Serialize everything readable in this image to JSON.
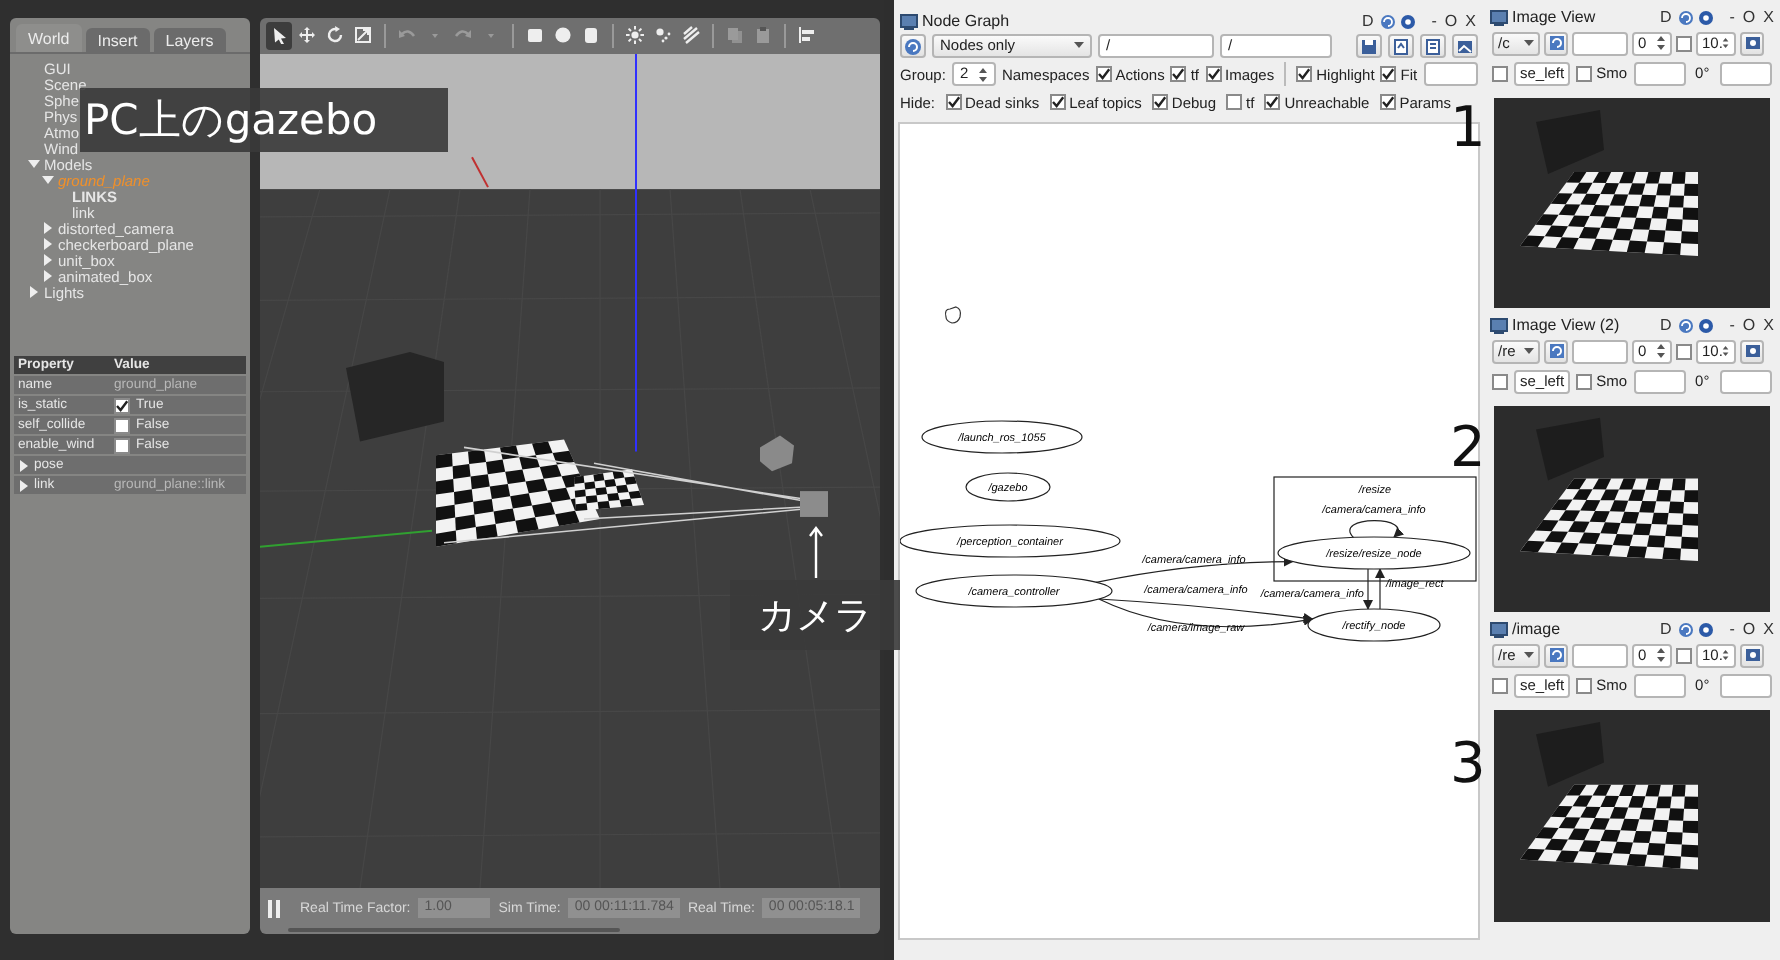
{
  "gazebo": {
    "tabs": [
      {
        "label": "World",
        "selected": true
      },
      {
        "label": "Insert",
        "selected": false
      },
      {
        "label": "Layers",
        "selected": false
      }
    ],
    "tree": [
      {
        "label": "GUI"
      },
      {
        "label": "Scene"
      },
      {
        "label": "Sphe"
      },
      {
        "label": "Phys"
      },
      {
        "label": "Atmo"
      },
      {
        "label": "Wind"
      },
      {
        "label": "Models",
        "expanded": true,
        "children": [
          {
            "label": "ground_plane",
            "expanded": true,
            "selected": true,
            "children": [
              {
                "label": "LINKS",
                "kind": "heading"
              },
              {
                "label": "link",
                "kind": "entry"
              }
            ]
          },
          {
            "label": "distorted_camera",
            "expanded": false,
            "selected": false
          },
          {
            "label": "checkerboard_plane",
            "expanded": false,
            "selected": false
          },
          {
            "label": "unit_box",
            "expanded": false,
            "selected": false
          },
          {
            "label": "animated_box",
            "expanded": false,
            "selected": false
          }
        ]
      },
      {
        "label": "Lights",
        "expanded": false
      }
    ],
    "properties": {
      "columns": [
        "Property",
        "Value"
      ],
      "rows": [
        {
          "kind": "text",
          "name": "name",
          "value": "ground_plane"
        },
        {
          "kind": "check",
          "name": "is_static",
          "checked": true,
          "value": "True"
        },
        {
          "kind": "check",
          "name": "self_collide",
          "checked": false,
          "value": "False"
        },
        {
          "kind": "check",
          "name": "enable_wind",
          "checked": false,
          "value": "False"
        },
        {
          "kind": "group",
          "name": "pose",
          "expanded": false
        },
        {
          "kind": "group",
          "name": "link",
          "expanded": false,
          "value": "ground_plane::link"
        }
      ]
    },
    "tools": [
      {
        "kind": "select",
        "selected": true,
        "disabled": false
      },
      {
        "kind": "translate",
        "selected": false,
        "disabled": false
      },
      {
        "kind": "rotate",
        "selected": false,
        "disabled": false
      },
      {
        "kind": "scale",
        "selected": false,
        "disabled": false
      },
      {
        "kind": "undo",
        "selected": false,
        "disabled": true
      },
      {
        "kind": "caret",
        "selected": false,
        "disabled": true
      },
      {
        "kind": "redo",
        "selected": false,
        "disabled": true
      },
      {
        "kind": "caret",
        "selected": false,
        "disabled": true
      },
      {
        "kind": "box",
        "selected": false,
        "disabled": false
      },
      {
        "kind": "sphere",
        "selected": false,
        "disabled": false
      },
      {
        "kind": "cylinder",
        "selected": false,
        "disabled": false
      },
      {
        "kind": "pointlight",
        "selected": false,
        "disabled": false
      },
      {
        "kind": "spotlight",
        "selected": false,
        "disabled": false
      },
      {
        "kind": "dirlight",
        "selected": false,
        "disabled": false
      },
      {
        "kind": "copy",
        "selected": false,
        "disabled": true
      },
      {
        "kind": "paste",
        "selected": false,
        "disabled": true
      },
      {
        "kind": "align",
        "selected": false,
        "disabled": false
      }
    ],
    "status": {
      "rtf_label": "Real Time Factor:",
      "rtf": "1.00",
      "sim_label": "Sim Time:",
      "sim": "00 00:11:11.784",
      "real_label": "Real Time:",
      "real": "00 00:05:18.1"
    }
  },
  "node_graph": {
    "title": "Node Graph",
    "title_controls": [
      "D",
      "-",
      "O",
      "X"
    ],
    "mode": "Nodes only",
    "namespace_filter": "/",
    "topic_filter": "/",
    "group_label": "Group:",
    "group_value": "2",
    "options": [
      {
        "label": "Namespaces",
        "kind": "text"
      },
      {
        "label": "Actions",
        "kind": "check",
        "checked": true
      },
      {
        "label": "tf",
        "kind": "check",
        "checked": true
      },
      {
        "label": "Images",
        "kind": "check",
        "checked": true
      },
      {
        "label": "Highlight",
        "kind": "check",
        "checked": true
      },
      {
        "label": "Fit",
        "kind": "check",
        "checked": true
      }
    ],
    "hide_label": "Hide:",
    "hide_options": [
      {
        "label": "Dead sinks",
        "checked": true
      },
      {
        "label": "Leaf topics",
        "checked": true
      },
      {
        "label": "Debug",
        "checked": true
      },
      {
        "label": "tf",
        "checked": false
      },
      {
        "label": "Unreachable",
        "checked": true
      },
      {
        "label": "Params",
        "checked": true
      }
    ],
    "graph": {
      "groups": [
        {
          "label": "/resize"
        }
      ],
      "nodes": [
        {
          "label": "/launch_ros_1055"
        },
        {
          "label": "/gazebo"
        },
        {
          "label": "/perception_container"
        },
        {
          "label": "/camera_controller"
        },
        {
          "label": "/resize/resize_node"
        },
        {
          "label": "/rectify_node"
        }
      ],
      "edges": [
        {
          "label": "/camera/camera_info"
        },
        {
          "label": "/camera/camera_info"
        },
        {
          "label": "/camera/image_raw"
        },
        {
          "label": "/camera/camera_info"
        },
        {
          "label": "/camera/camera_info"
        },
        {
          "label": "/image_rect"
        }
      ]
    }
  },
  "image_views": [
    {
      "title": "Image View",
      "title_controls": [
        "D",
        "-",
        "O",
        "X"
      ],
      "topic": "/c",
      "frame_value": "0",
      "scale_checked": false,
      "scale_value": "10.",
      "flip_checked": false,
      "suffix": "se_left",
      "smooth_label": "Smo",
      "smooth_checked": false,
      "rotation": "0°"
    },
    {
      "title": "Image View (2)",
      "title_controls": [
        "D",
        "-",
        "O",
        "X"
      ],
      "topic": "/re",
      "frame_value": "0",
      "scale_checked": false,
      "scale_value": "10.",
      "flip_checked": false,
      "suffix": "se_left",
      "smooth_label": "Smo",
      "smooth_checked": false,
      "rotation": "0°"
    },
    {
      "title": "/image",
      "title_controls": [
        "D",
        "-",
        "O",
        "X"
      ],
      "topic": "/re",
      "frame_value": "0",
      "scale_checked": false,
      "scale_value": "10.",
      "flip_checked": false,
      "suffix": "se_left",
      "smooth_label": "Smo",
      "smooth_checked": false,
      "rotation": "0°"
    }
  ],
  "overlays": {
    "title_caption": "PC上のgazebo",
    "camera_caption": "カメラ",
    "panel_numbers": [
      "1",
      "2",
      "3"
    ]
  }
}
